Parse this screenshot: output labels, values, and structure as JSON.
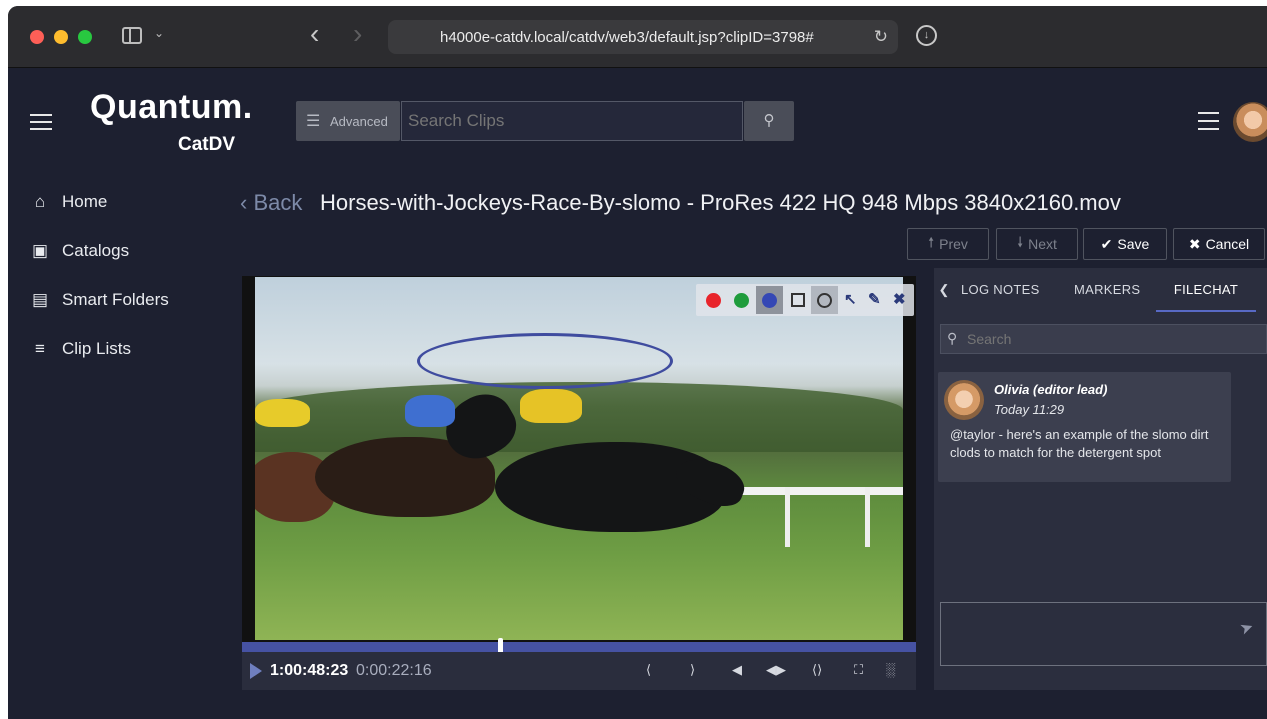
{
  "browser": {
    "url": "h4000e-catdv.local/catdv/web3/default.jsp?clipID=3798#",
    "icons": [
      "sidebar-toggle-icon",
      "chevron-down-icon",
      "back-icon",
      "forward-icon",
      "reload-icon",
      "download-icon"
    ]
  },
  "header": {
    "logo_main": "Quantum.",
    "logo_sub": "CatDV",
    "advanced_label": "Advanced",
    "search_placeholder": "Search Clips"
  },
  "sidebar": {
    "items": [
      {
        "label": "Home",
        "icon": "home-icon"
      },
      {
        "label": "Catalogs",
        "icon": "bag-icon"
      },
      {
        "label": "Smart Folders",
        "icon": "list-box-icon"
      },
      {
        "label": "Clip Lists",
        "icon": "list-icon"
      }
    ]
  },
  "clip": {
    "back_label": "Back",
    "title": "Horses-with-Jockeys-Race-By-slomo - ProRes 422 HQ 948 Mbps 3840x2160.mov"
  },
  "actions": {
    "prev": "Prev",
    "next": "Next",
    "save": "Save",
    "cancel": "Cancel"
  },
  "player": {
    "timecode": "1:00:48:23",
    "duration": "0:00:22:16",
    "playhead_fraction": 0.38,
    "annotation_colors": [
      "#e8242b",
      "#1f9c3c",
      "#3548b5"
    ],
    "annotation_tools": [
      "rectangle-tool-icon",
      "ellipse-tool-icon",
      "arrow-tool-icon",
      "pen-tool-icon",
      "close-icon"
    ]
  },
  "panel": {
    "tabs": [
      {
        "label": "LOG NOTES",
        "active": false
      },
      {
        "label": "MARKERS",
        "active": false
      },
      {
        "label": "FILECHAT",
        "active": true
      }
    ],
    "search_placeholder": "Search",
    "messages": [
      {
        "author": "Olivia (editor lead)",
        "time": "Today 11:29",
        "body": "@taylor - here's an example of the slomo dirt clods to match for the detergent spot"
      }
    ]
  },
  "colors": {
    "background": "#1d2030",
    "panel": "#2b2e3e",
    "accent": "#4652a3",
    "tab_underline": "#5869c4"
  }
}
